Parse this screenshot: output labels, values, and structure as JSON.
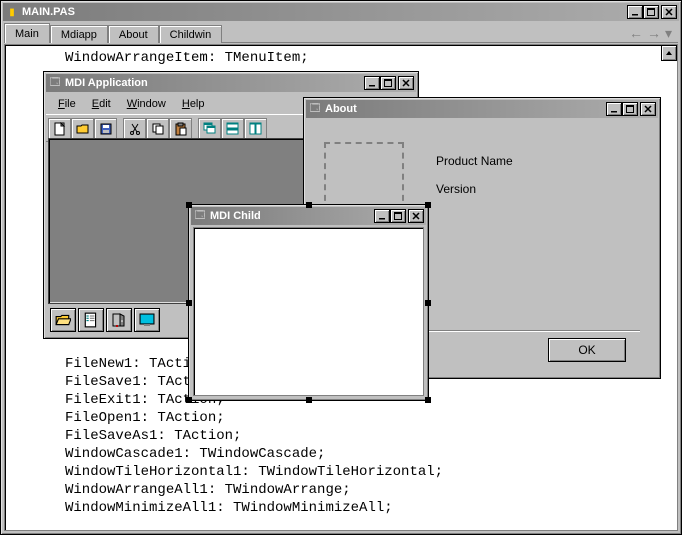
{
  "main": {
    "title": "MAIN.PAS",
    "tabs": [
      "Main",
      "Mdiapp",
      "About",
      "Childwin"
    ],
    "code_lines": [
      "WindowArrangeItem: TMenuItem;",
      "",
      "",
      "",
      "",
      "",
      "",
      "",
      "",
      "",
      "",
      "",
      "",
      "",
      "",
      "",
      "",
      "FileNew1: TAction;",
      "FileSave1: TAction;",
      "FileExit1: TAction;",
      "FileOpen1: TAction;",
      "FileSaveAs1: TAction;",
      "WindowCascade1: TWindowCascade;",
      "WindowTileHorizontal1: TWindowTileHorizontal;",
      "WindowArrangeAll1: TWindowArrange;",
      "WindowMinimizeAll1: TWindowMinimizeAll;"
    ]
  },
  "mdi": {
    "title": "MDI Application",
    "menus": [
      {
        "label": "File",
        "accel": "F"
      },
      {
        "label": "Edit",
        "accel": "E"
      },
      {
        "label": "Window",
        "accel": "W"
      },
      {
        "label": "Help",
        "accel": "H"
      }
    ],
    "tools": [
      "new",
      "open",
      "save",
      "cut",
      "copy",
      "paste",
      "cascade",
      "tile-h",
      "tile-v"
    ],
    "taskbtns": [
      "openfolder",
      "props",
      "exit",
      "desktop"
    ]
  },
  "about": {
    "title": "About",
    "product_label": "Product Name",
    "version_label": "Version",
    "ok": "OK"
  },
  "child": {
    "title": "MDI Child"
  }
}
